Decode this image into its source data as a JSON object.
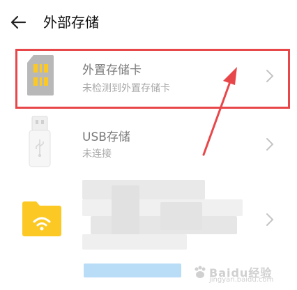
{
  "header": {
    "title": "外部存储"
  },
  "items": [
    {
      "title": "外置存储卡",
      "subtitle": "未检测到外置存储卡"
    },
    {
      "title": "USB存储",
      "subtitle": "未连接"
    }
  ],
  "watermark": {
    "text": "Baidu经验",
    "url": "jingyan.baidu.com"
  },
  "colors": {
    "highlight": "#e8474a",
    "folder": "#fcc924",
    "text_primary": "#7a7a7a",
    "text_secondary": "#a8a8a8"
  }
}
